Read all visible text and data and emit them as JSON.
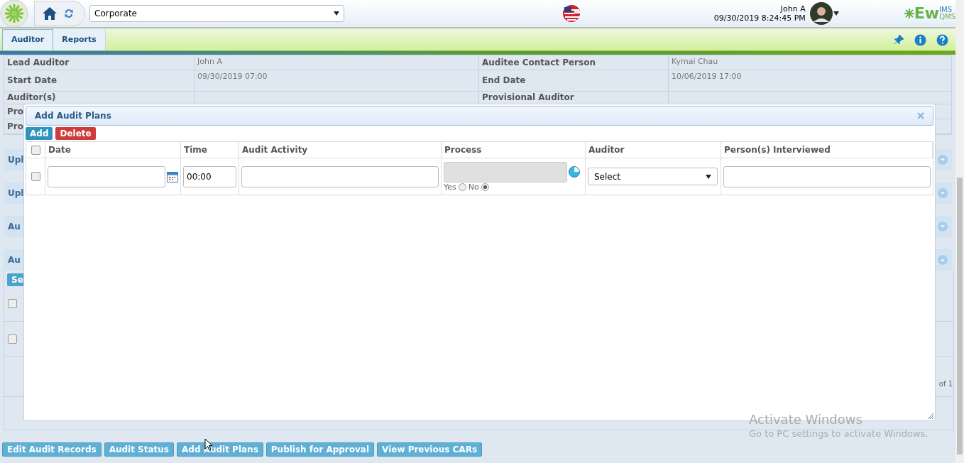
{
  "header": {
    "company": "Corporate",
    "user": {
      "name": "John A",
      "datetime": "09/30/2019 8:24:45 PM"
    },
    "brand": {
      "main": "Ew",
      "top": "IMS",
      "bottom": "QMS"
    }
  },
  "nav": {
    "tabs": [
      {
        "label": "Auditor",
        "selected": true
      },
      {
        "label": "Reports",
        "selected": false
      }
    ]
  },
  "details": [
    {
      "label": "Lead Auditor",
      "value": "John A",
      "label2": "Auditee Contact Person",
      "value2": "Kymai Chau"
    },
    {
      "label": "Start Date",
      "value": "09/30/2019 07:00",
      "label2": "End Date",
      "value2": "10/06/2019 17:00"
    },
    {
      "label": "Auditor(s)",
      "label2": "Provisional Auditor"
    },
    {
      "label": "Pro"
    },
    {
      "label": "Pro"
    }
  ],
  "sections": [
    {
      "label": "Upl",
      "expanded": false
    },
    {
      "label": "Upl",
      "expanded": false
    },
    {
      "label": "Au",
      "expanded": false
    },
    {
      "label": "Au",
      "expanded": true
    }
  ],
  "grid": {
    "button": "Se",
    "rows": [
      {
        "checked": false
      },
      {
        "checked": false
      }
    ],
    "pager": "of 1"
  },
  "modal": {
    "title": "Add Audit Plans",
    "toolbar": [
      {
        "label": "Add",
        "kind": "primary"
      },
      {
        "label": "Delete",
        "kind": "danger"
      }
    ],
    "columns": [
      "Date",
      "Time",
      "Audit Activity",
      "Process",
      "Auditor",
      "Person(s) Interviewed"
    ],
    "select_all": false,
    "row": {
      "checked": false,
      "time": "00:00",
      "process_options": [
        {
          "label": "Yes",
          "selected": false
        },
        {
          "label": "No",
          "selected": true
        }
      ],
      "auditor": "Select"
    }
  },
  "actions": [
    "Edit Audit Records",
    "Audit Status",
    "Add Audit Plans",
    "Publish for Approval",
    "View Previous CARs"
  ],
  "system_notice": {
    "title": "Activate Windows",
    "subtitle": "Go to PC settings to activate Windows."
  }
}
